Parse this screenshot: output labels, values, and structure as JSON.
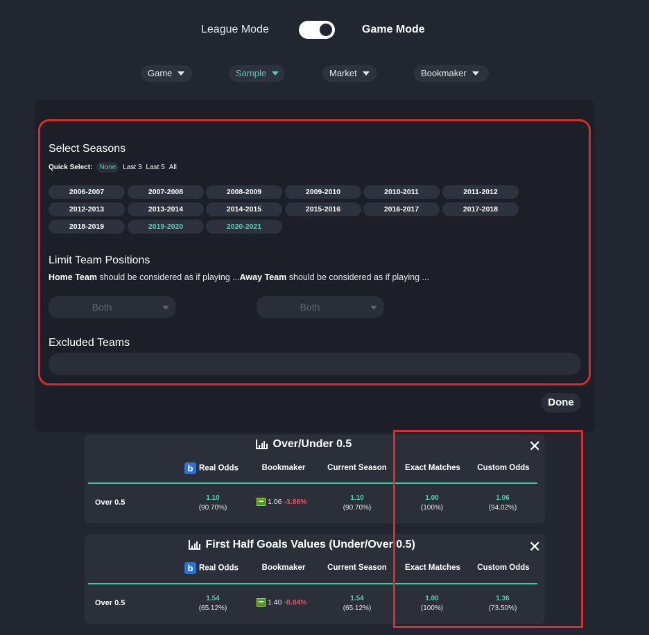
{
  "mode_toggle": {
    "left_label": "League Mode",
    "right_label": "Game Mode",
    "active": "Game Mode"
  },
  "filters": [
    {
      "label": "Game",
      "active": false
    },
    {
      "label": "Sample",
      "active": true
    },
    {
      "label": "Market",
      "active": false
    },
    {
      "label": "Bookmaker",
      "active": false
    }
  ],
  "seasons_panel": {
    "title": "Select Seasons",
    "quick_select_label": "Quick Select:",
    "quick_select_options": [
      "None",
      "Last 3",
      "Last 5",
      "All"
    ],
    "quick_select_selected": "None",
    "seasons": [
      "2006-2007",
      "2007-2008",
      "2008-2009",
      "2009-2010",
      "2010-2011",
      "2011-2012",
      "2012-2013",
      "2013-2014",
      "2014-2015",
      "2015-2016",
      "2016-2017",
      "2017-2018",
      "2018-2019",
      "2019-2020",
      "2020-2021"
    ],
    "selected_seasons": [
      "2019-2020",
      "2020-2021"
    ],
    "limit_title": "Limit Team Positions",
    "home_team": "Home Team",
    "home_desc": " should be considered as if playing ...",
    "away_team": "Away Team",
    "away_desc": " should be considered as if playing ...",
    "home_select": "Both",
    "away_select": "Both",
    "excluded_title": "Excluded Teams",
    "excluded_value": "",
    "done_label": "Done"
  },
  "columns": [
    "Real Odds",
    "Bookmaker",
    "Current Season",
    "Exact Matches",
    "Custom Odds"
  ],
  "cards": [
    {
      "title": "Over/Under 0.5",
      "row_label": "Over 0.5",
      "real_odds": "1.10",
      "real_pct": "(90.70%)",
      "bookmaker_odds": "1.06",
      "bookmaker_change": "-3.86%",
      "current_season": "1.10",
      "current_pct": "(90.70%)",
      "exact_matches": "1.00",
      "exact_pct": "(100%)",
      "custom_odds": "1.06",
      "custom_pct": "(94.02%)"
    },
    {
      "title": "First Half Goals Values (Under/Over 0.5)",
      "row_label": "Over 0.5",
      "real_odds": "1.54",
      "real_pct": "(65.12%)",
      "bookmaker_odds": "1.40",
      "bookmaker_change": "-8.84%",
      "current_season": "1.54",
      "current_pct": "(65.12%)",
      "exact_matches": "1.00",
      "exact_pct": "(100%)",
      "custom_odds": "1.36",
      "custom_pct": "(73.50%)"
    }
  ],
  "bookmaker_logo_letter": "b",
  "colors": {
    "accent": "#4fd1b5",
    "negative": "#ea4f5f",
    "highlight": "#d3302c",
    "background": "#222631"
  }
}
